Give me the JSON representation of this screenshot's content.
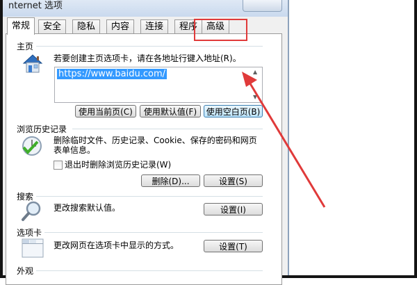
{
  "window": {
    "title": "nternet 选项"
  },
  "tabs": [
    {
      "label": "常规",
      "active": true
    },
    {
      "label": "安全"
    },
    {
      "label": "隐私"
    },
    {
      "label": "内容"
    },
    {
      "label": "连接"
    },
    {
      "label": "程序"
    },
    {
      "label": "高级"
    }
  ],
  "homepage": {
    "title": "主页",
    "description": "若要创建主页选项卡，请在各地址行键入地址(R)。",
    "value": "https://www.baidu.com/",
    "buttons": {
      "use_current": "使用当前页(C)",
      "use_default": "使用默认值(F)",
      "use_blank": "使用空白页(B)"
    }
  },
  "history": {
    "title": "浏览历史记录",
    "description_line1": "删除临时文件、历史记录、Cookie、保存的密码和网页",
    "description_line2": "表单信息。",
    "checkbox_label": "退出时删除浏览历史记录(W)",
    "buttons": {
      "delete": "删除(D)...",
      "settings": "设置(S)"
    }
  },
  "search": {
    "title": "搜索",
    "description": "更改搜索默认值。",
    "settings_button": "设置(I)"
  },
  "tabs_section": {
    "title": "选项卡",
    "description": "更改网页在选项卡中显示的方式。",
    "settings_button": "设置(T)"
  },
  "appearance": {
    "title": "外观"
  },
  "colors": {
    "highlight_border": "#e03a3a",
    "arrow": "#e03a3a",
    "selection": "#3399ff"
  },
  "icons": {
    "homepage": "house-icon",
    "history": "clock-check-icon",
    "search": "magnifier-icon",
    "tabs": "tabs-window-icon"
  }
}
